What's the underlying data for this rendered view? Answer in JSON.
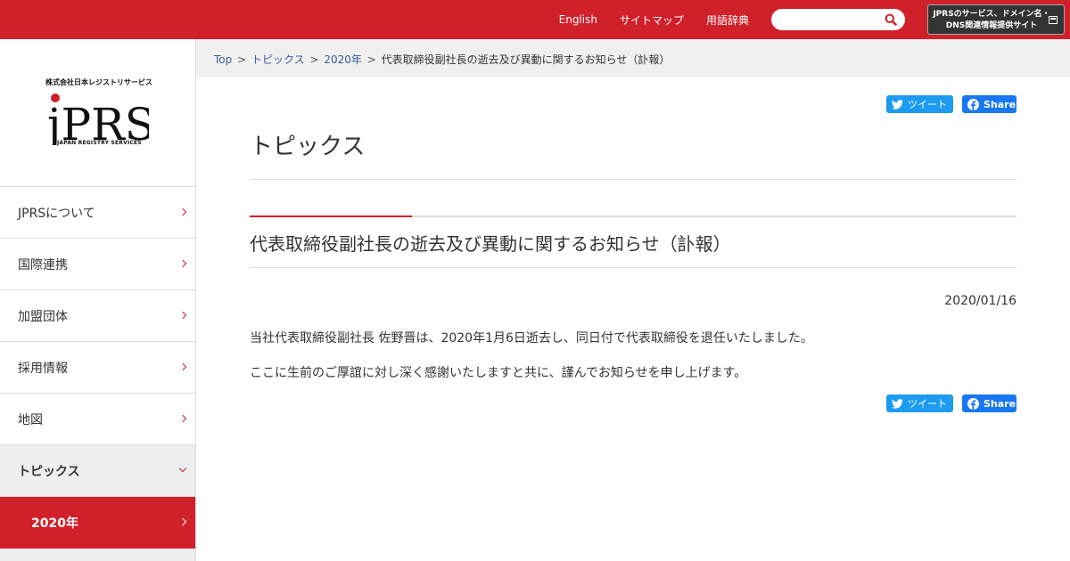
{
  "header": {
    "links": [
      "English",
      "サイトマップ",
      "用語辞典"
    ],
    "search_placeholder": "",
    "services_line1": "JPRSのサービス、ドメイン名・",
    "services_line2": "DNS関連情報提供サイト"
  },
  "logo": {
    "caption": "株式会社日本レジストリサービス",
    "mark": "jPRS",
    "sub": "JAPAN REGISTRY SERVICES"
  },
  "sidebar": {
    "items": [
      {
        "label": "JPRSについて"
      },
      {
        "label": "国際連携"
      },
      {
        "label": "加盟団体"
      },
      {
        "label": "採用情報"
      },
      {
        "label": "地図"
      },
      {
        "label": "トピックス"
      },
      {
        "label": "2020年"
      }
    ]
  },
  "breadcrumb": {
    "items": [
      "Top",
      "トピックス",
      "2020年"
    ],
    "current": "代表取締役副社長の逝去及び異動に関するお知らせ（訃報）",
    "separator": ">"
  },
  "share": {
    "tweet_label": "ツイート",
    "fb_label": "Share"
  },
  "main": {
    "page_title": "トピックス",
    "article_title": "代表取締役副社長の逝去及び異動に関するお知らせ（訃報）",
    "date": "2020/01/16",
    "paragraphs": [
      "当社代表取締役副社長 佐野晋は、2020年1月6日逝去し、同日付で代表取締役を退任いたしました。",
      "ここに生前のご厚誼に対し深く感謝いたしますと共に、謹んでお知らせを申し上げます。"
    ]
  },
  "colors": {
    "brand_red": "#d0202a",
    "twitter_blue": "#1d9bf0",
    "facebook_blue": "#1877f2"
  }
}
